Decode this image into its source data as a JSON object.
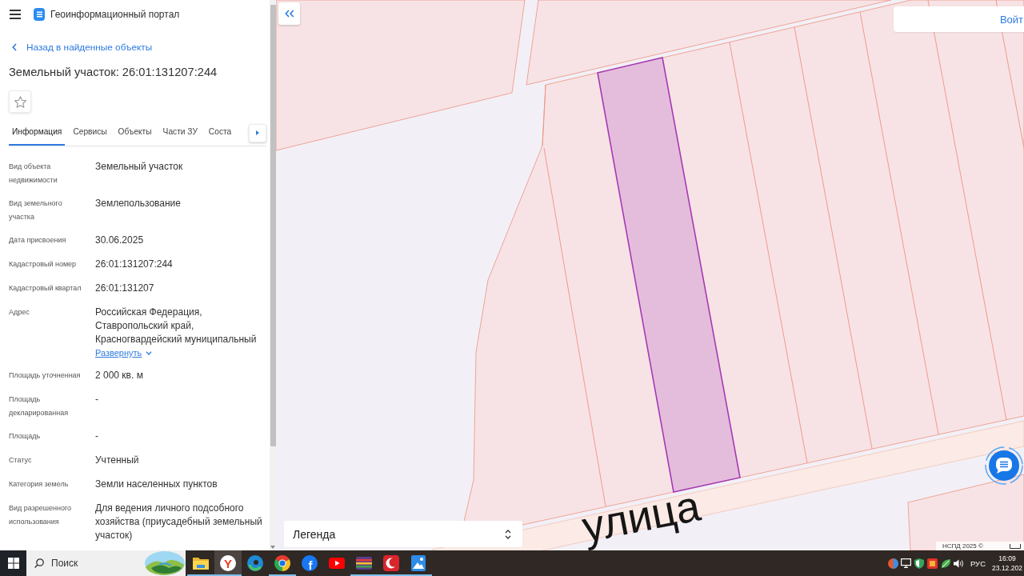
{
  "header": {
    "title": "Геоинформационный портал"
  },
  "back_link": "Назад в найденные объекты",
  "object": {
    "title": "Земельный участок: 26:01:131207:244",
    "favorite": false
  },
  "tabs": [
    {
      "label": "Информация",
      "selected": true
    },
    {
      "label": "Сервисы",
      "selected": false
    },
    {
      "label": "Объекты",
      "selected": false
    },
    {
      "label": "Части ЗУ",
      "selected": false
    },
    {
      "label": "Соста",
      "selected": false
    }
  ],
  "properties": [
    {
      "label": "Вид объекта недвижимости",
      "value": "Земельный участок"
    },
    {
      "label": "Вид земельного участка",
      "value": "Землепользование"
    },
    {
      "label": "Дата присвоения",
      "value": "30.06.2025"
    },
    {
      "label": "Кадастровый номер",
      "value": "26:01:131207:244"
    },
    {
      "label": "Кадастровый квартал",
      "value": "26:01:131207"
    },
    {
      "label": "Адрес",
      "value": "Российская Федерация, Ставропольский край, Красногвардейский муниципальный",
      "expand_link": {
        "label": "Развернуть",
        "expanded": false
      }
    },
    {
      "label": "Площадь уточненная",
      "value": "2 000 кв. м"
    },
    {
      "label": "Площадь декларированная",
      "value": "-"
    },
    {
      "label": "Площадь",
      "value": "-"
    },
    {
      "label": "Статус",
      "value": "Учтенный"
    },
    {
      "label": "Категория земель",
      "value": "Земли населенных пунктов"
    },
    {
      "label": "Вид разрешенного использования",
      "value": "Для ведения личного подсобного хозяйства (приусадебный земельный участок)"
    }
  ],
  "map": {
    "street_label": "улица",
    "login_button": "Войт",
    "legend": "Легенда",
    "attribution": "НСПД 2025 ©"
  },
  "taskbar": {
    "search": {
      "placeholder": "Поиск"
    },
    "apps": [
      {
        "kind": "folder",
        "running": true,
        "selected": false
      },
      {
        "kind": "letter",
        "glyph": "Y",
        "color": "#f33a22",
        "running": true,
        "selected": true
      },
      {
        "kind": "swirl",
        "running": false,
        "selected": false
      },
      {
        "kind": "wheel",
        "running": true,
        "selected": false
      },
      {
        "kind": "badge",
        "glyph": "f",
        "color": "#1877f2",
        "running": false,
        "selected": false
      },
      {
        "kind": "play",
        "running": false,
        "selected": false
      },
      {
        "kind": "stripes",
        "running": true,
        "selected": false
      },
      {
        "kind": "crescent",
        "running": true,
        "selected": false
      },
      {
        "kind": "picture",
        "running": true,
        "selected": false
      }
    ],
    "language": "РУС",
    "time": "16:09",
    "date": "23.12.202"
  }
}
